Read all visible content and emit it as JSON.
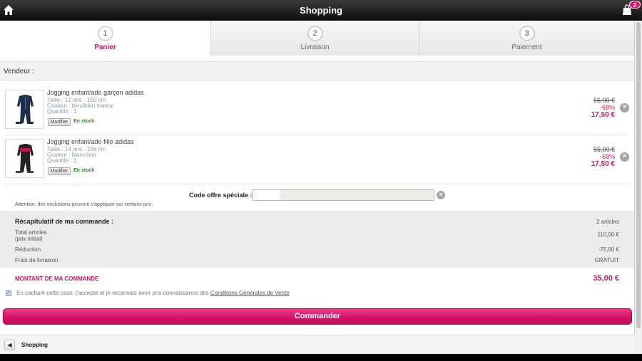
{
  "topbar": {
    "title": "Shopping",
    "cart_count": "2"
  },
  "steps": [
    {
      "number": "1",
      "label": "Panier"
    },
    {
      "number": "2",
      "label": "Livraison"
    },
    {
      "number": "3",
      "label": "Paiement"
    }
  ],
  "vendeur": {
    "label": "Vendeur :"
  },
  "items": [
    {
      "name": "Jogging enfant/ado garçon adidas",
      "taille": "Taille : 12 ans - 150 cm",
      "couleur": "Couleur : bleu/bleu marine",
      "quantite": "Quantité : 1",
      "modifier_label": "Modifier",
      "stock": "En stock",
      "price_old": "55,00 €",
      "discount": "-68%",
      "price_new": "17,50 €",
      "remove_icon": "close-icon"
    },
    {
      "name": "Jogging enfant/ado fille adidas",
      "taille": "Taille : 14 ans - 156 cm",
      "couleur": "Couleur : blanc/noir",
      "quantite": "Quantité : 1",
      "modifier_label": "Modifier",
      "stock": "En stock",
      "price_old": "55,00 €",
      "discount": "-68%",
      "price_new": "17,50 €",
      "remove_icon": "close-icon"
    }
  ],
  "promo": {
    "label": "Code offre spéciale :",
    "value": "",
    "placeholder": "",
    "notice": "Attention, des exclusions peuvent s'appliquer sur certains prix."
  },
  "summary": {
    "title": "Récapitulatif de ma commande :",
    "count": "2 articles",
    "total_articles_label": "Total articles",
    "total_articles_sub": "(prix initial)",
    "total_articles_value": "110,00 €",
    "reduction_label": "Réduction",
    "reduction_value": "-75,00 €",
    "frais_label": "Frais de livraison",
    "frais_value": "GRATUIT"
  },
  "total": {
    "label": "MONTANT DE MA COMMANDE",
    "value": "35,00 €"
  },
  "cgv": {
    "text": "En cochant cette case, j'accepte et je reconnais avoir pris connaissance des",
    "link": "Conditions Générales de Vente",
    "checked": true
  },
  "order_button": {
    "label": "Commander"
  },
  "bottombar": {
    "label": "Shopping"
  },
  "colors": {
    "accent": "#d7126a",
    "price": "#c8175d",
    "stock": "#2a8a2a"
  }
}
